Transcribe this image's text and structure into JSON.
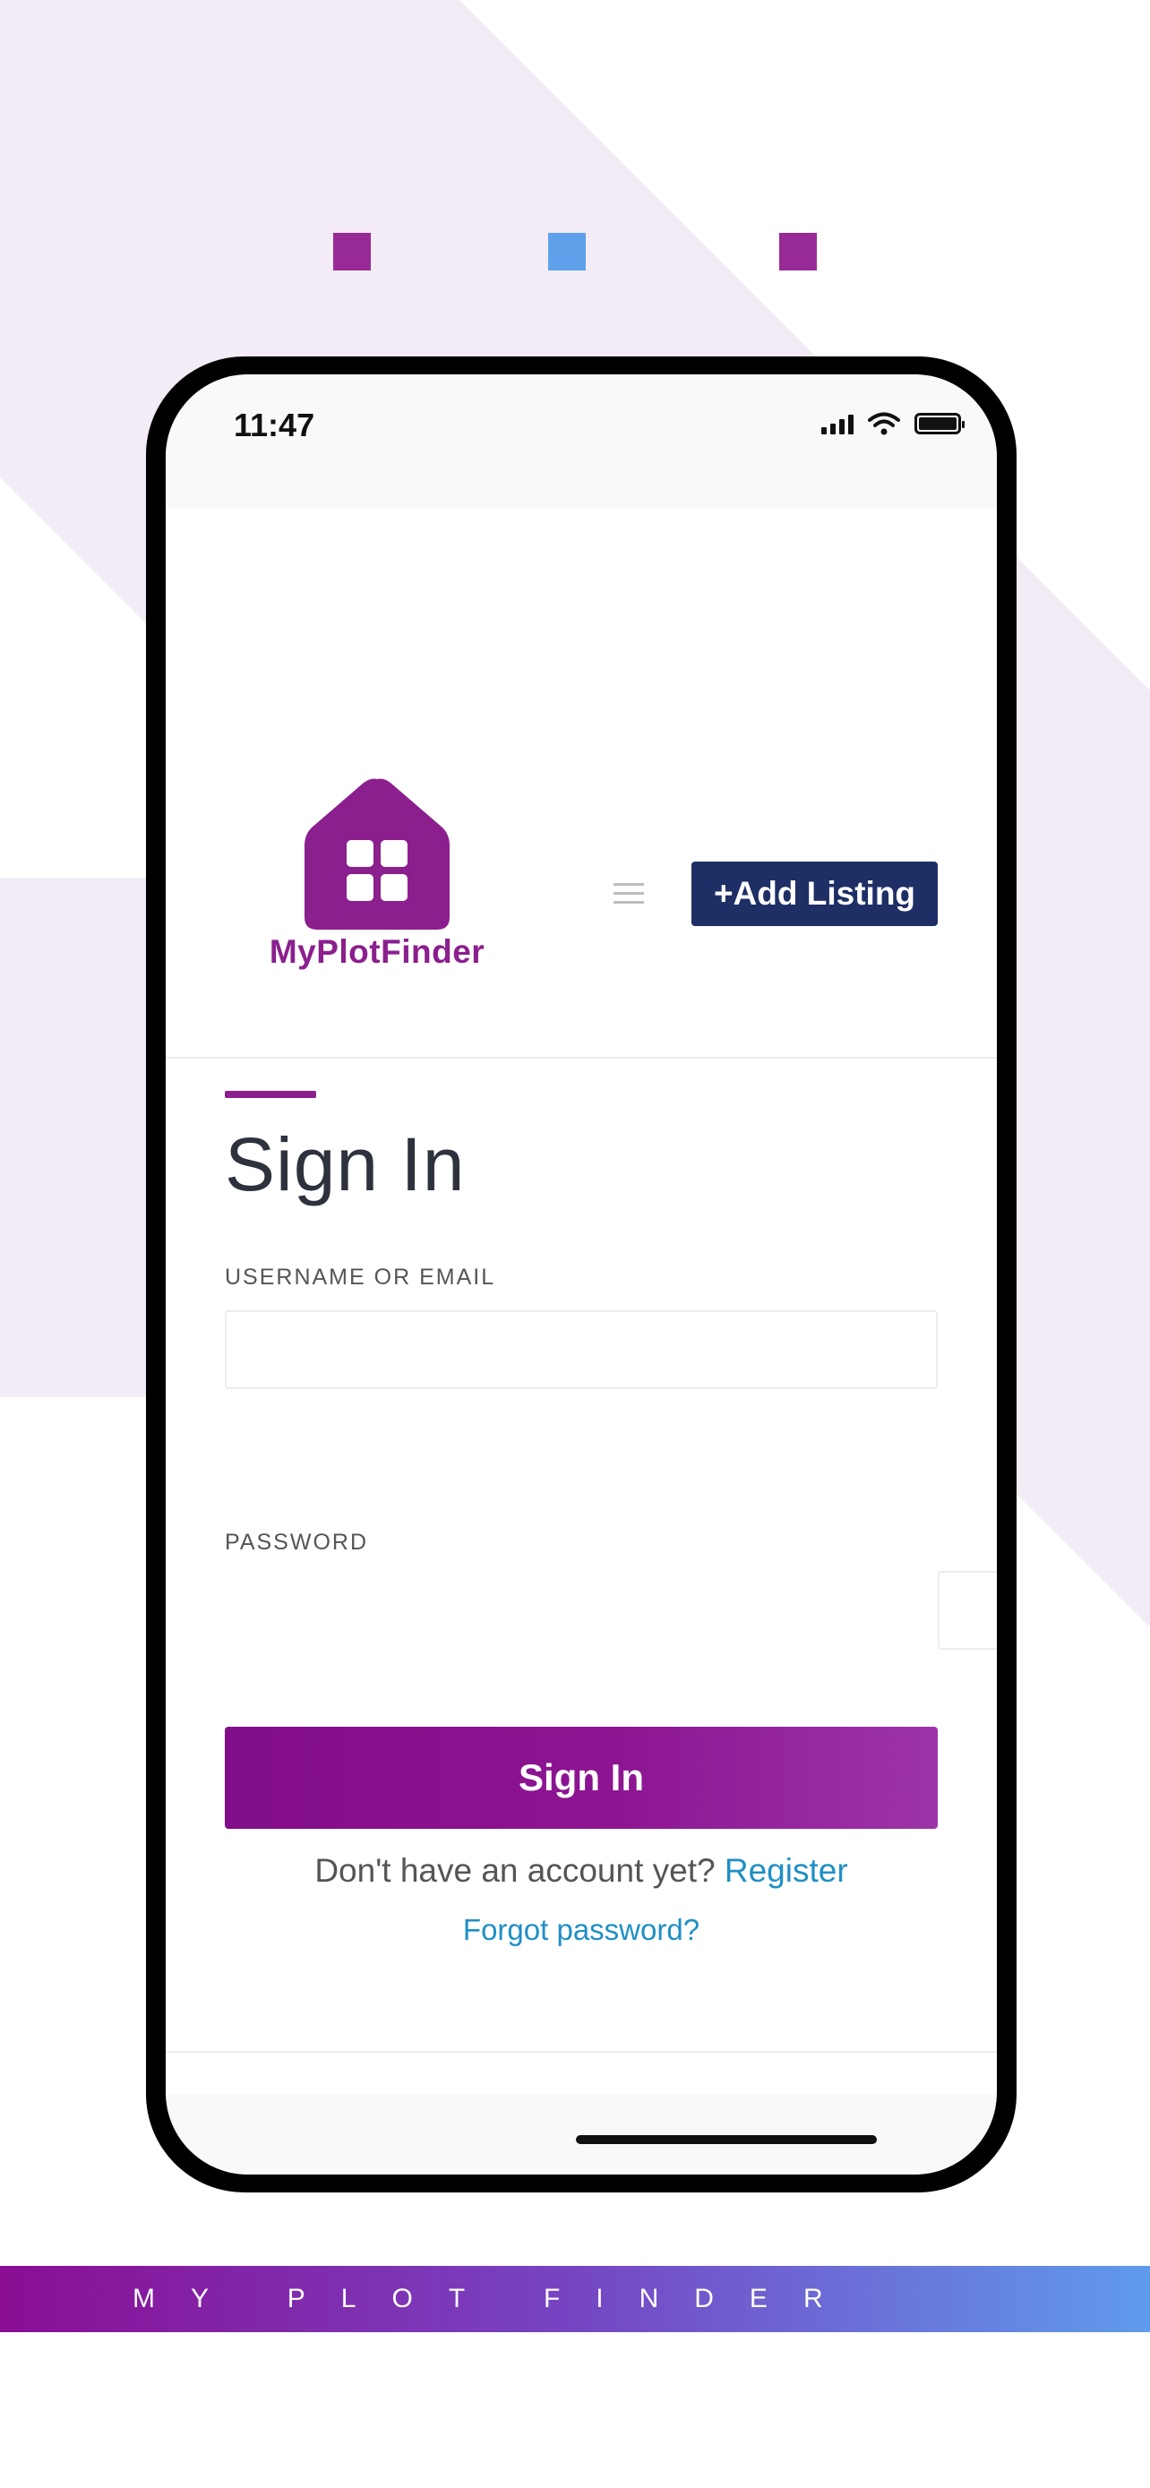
{
  "colors": {
    "brand_purple": "#8b1f8e",
    "accent_blue": "#5ea1ea",
    "navy": "#1e2f66",
    "link_blue": "#1f8fc5",
    "bg_tint": "#f3ecf6"
  },
  "status_bar": {
    "time": "11:47",
    "icons": [
      "cellular-signal-icon",
      "wifi-icon",
      "battery-icon"
    ]
  },
  "header": {
    "logo_text": "MyPlotFinder",
    "menu_icon": "hamburger-icon",
    "add_listing_label": "+Add Listing"
  },
  "form": {
    "title": "Sign In",
    "username_label": "USERNAME OR EMAIL",
    "username_value": "",
    "password_label": "PASSWORD",
    "password_value": "",
    "submit_label": "Sign In",
    "no_account_text": "Don't have an account yet?",
    "register_link": "Register",
    "forgot_link": "Forgot password?"
  },
  "banner": {
    "text": "MY PLOT FINDER"
  }
}
